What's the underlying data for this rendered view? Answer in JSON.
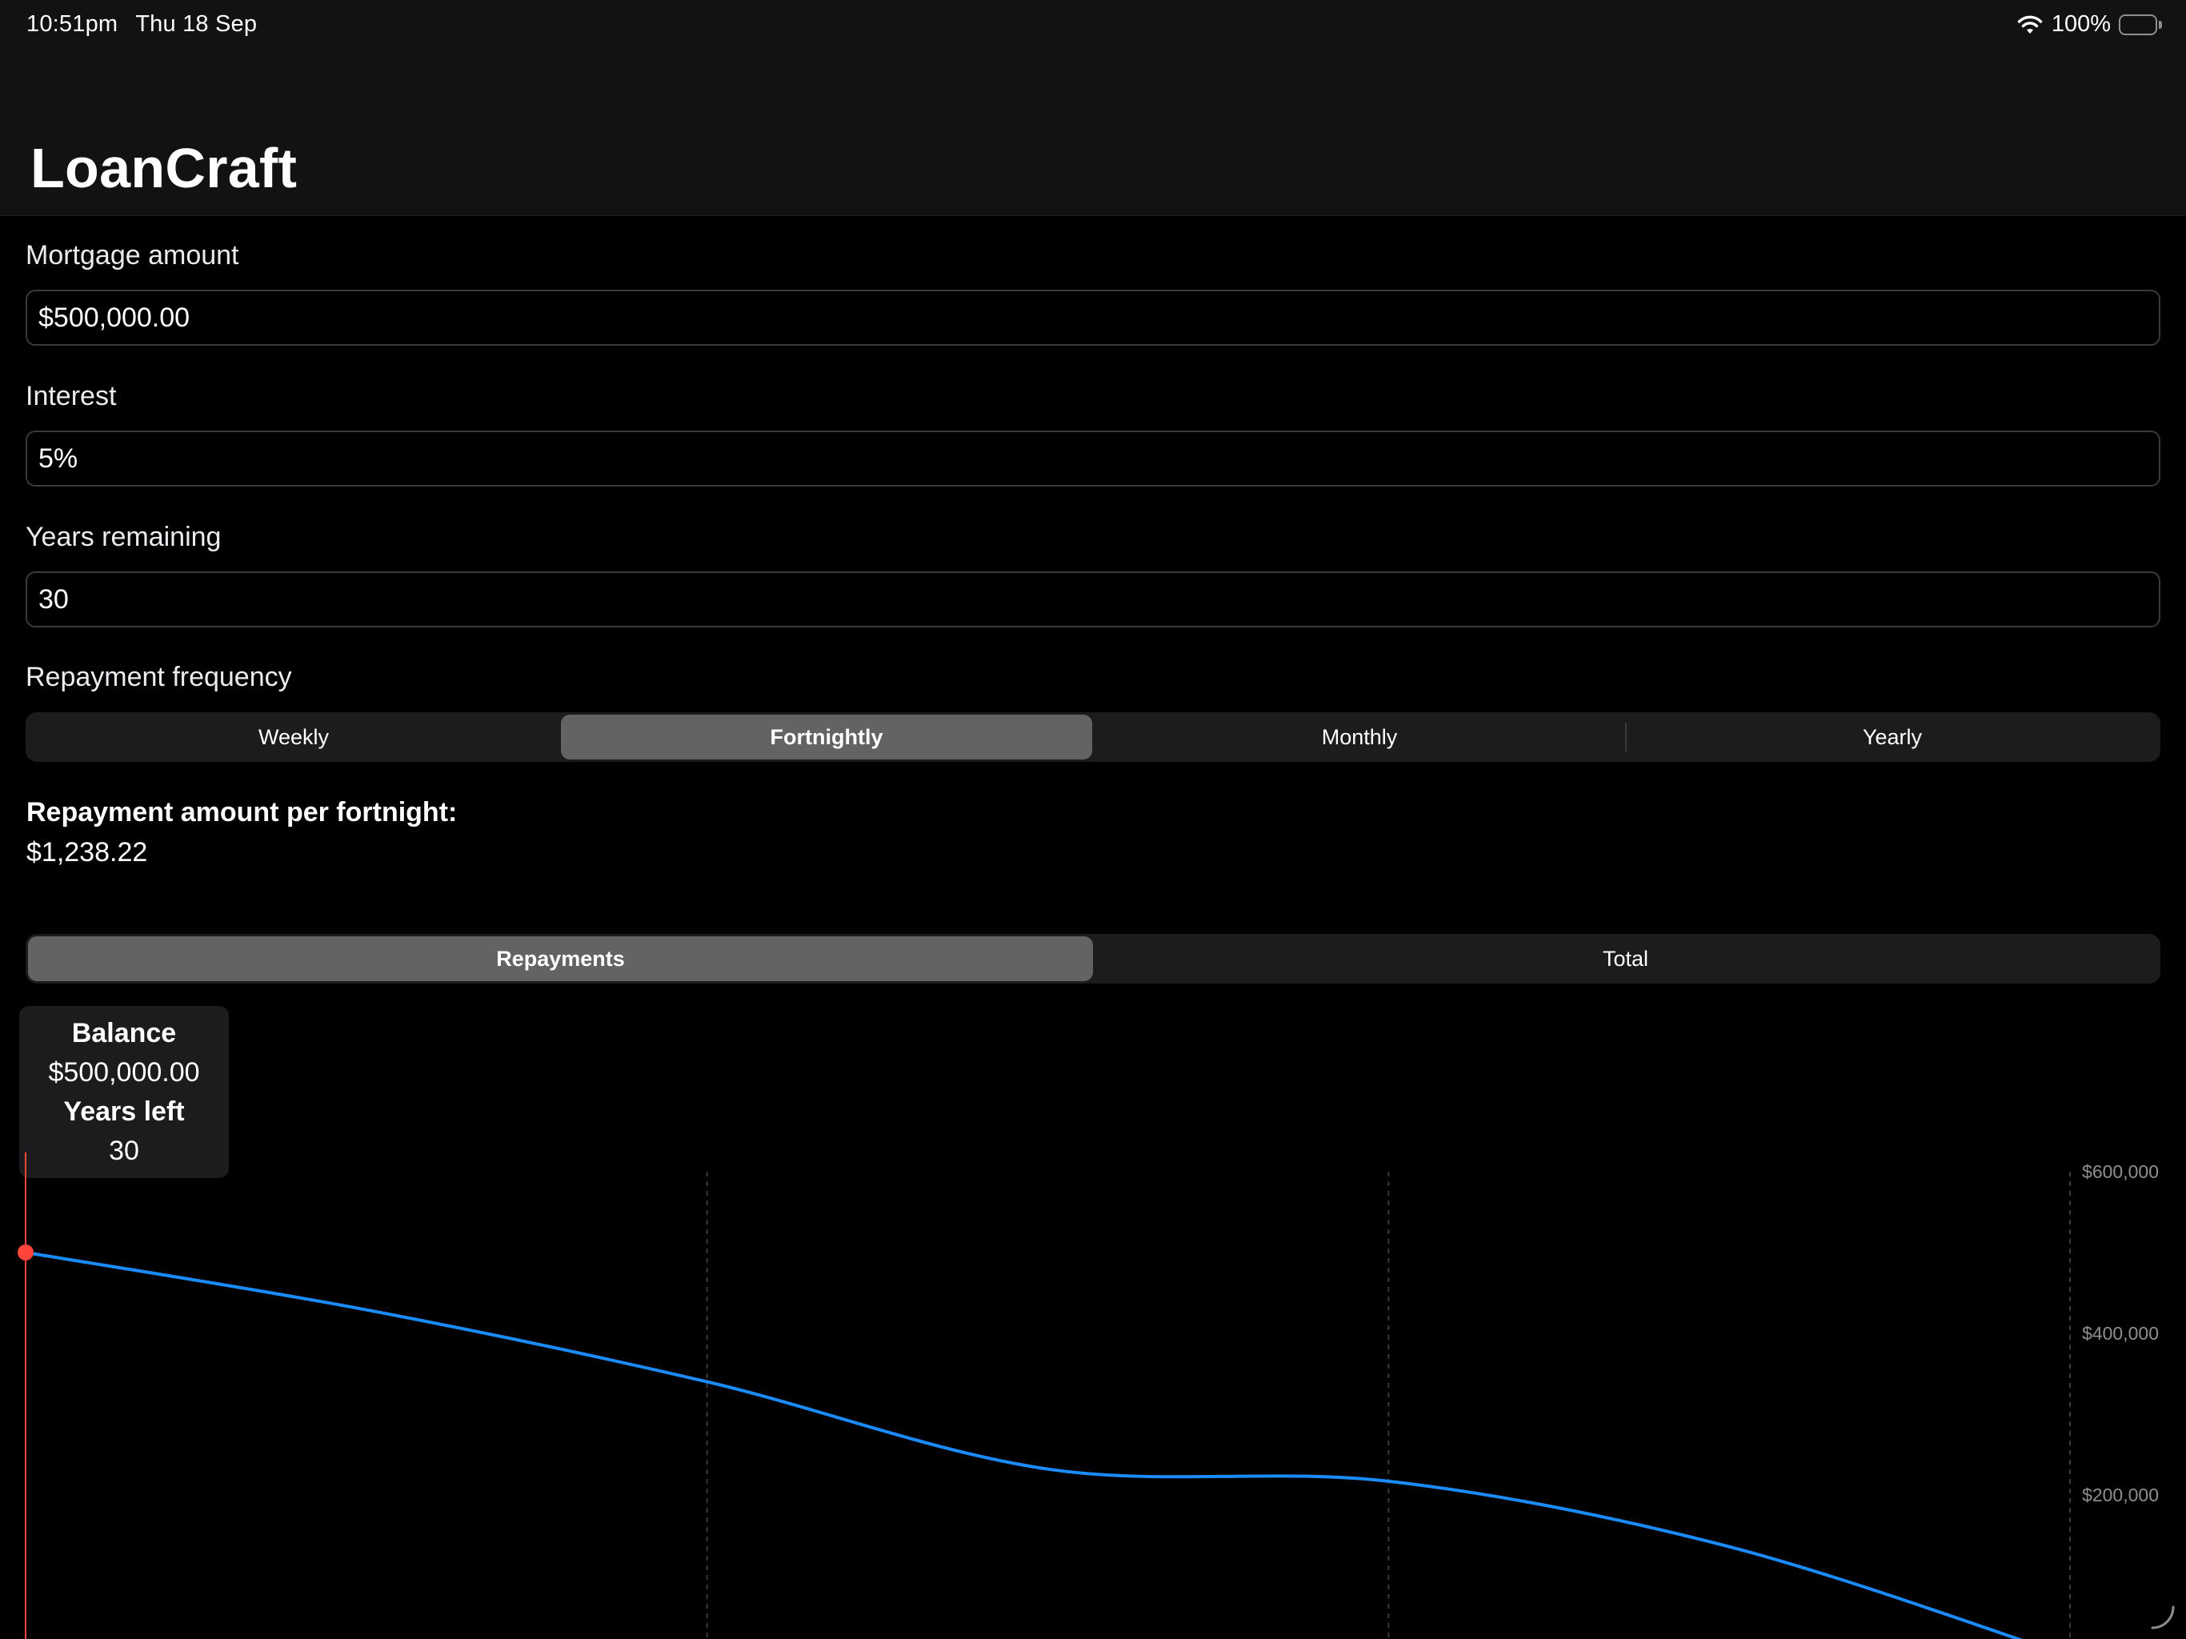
{
  "status_bar": {
    "time": "10:51pm",
    "date": "Thu 18 Sep",
    "battery": "100%"
  },
  "header": {
    "title": "LoanCraft"
  },
  "form": {
    "mortgage": {
      "label": "Mortgage amount",
      "value": "$500,000.00"
    },
    "interest": {
      "label": "Interest",
      "value": "5%"
    },
    "years": {
      "label": "Years remaining",
      "value": "30"
    },
    "frequency": {
      "label": "Repayment frequency",
      "options": [
        "Weekly",
        "Fortnightly",
        "Monthly",
        "Yearly"
      ],
      "selected": "Fortnightly"
    }
  },
  "result": {
    "label": "Repayment amount per fortnight:",
    "value": "$1,238.22"
  },
  "chart_tabs": {
    "options": [
      "Repayments",
      "Total"
    ],
    "selected": "Repayments"
  },
  "tooltip": {
    "balance_label": "Balance",
    "balance_value": "$500,000.00",
    "years_label": "Years left",
    "years_value": "30"
  },
  "colors": {
    "line": "#1a8cff",
    "marker": "#ff453a",
    "selected_segment": "#636366",
    "segment_bg": "#1c1c1e"
  },
  "chart_data": {
    "type": "line",
    "y_tick_labels": [
      "$600,000",
      "$400,000",
      "$200,000"
    ],
    "ylim": [
      0,
      600000
    ],
    "x": [
      30,
      25,
      20,
      15,
      10,
      5,
      0
    ],
    "xlim": [
      30,
      0
    ],
    "series": [
      {
        "values": [
          500000,
          429000,
          340000,
          232000,
          217000,
          136000,
          0
        ]
      }
    ],
    "grid": "vertical-dashed",
    "selected_point": {
      "x": 30,
      "y": 500000
    }
  }
}
